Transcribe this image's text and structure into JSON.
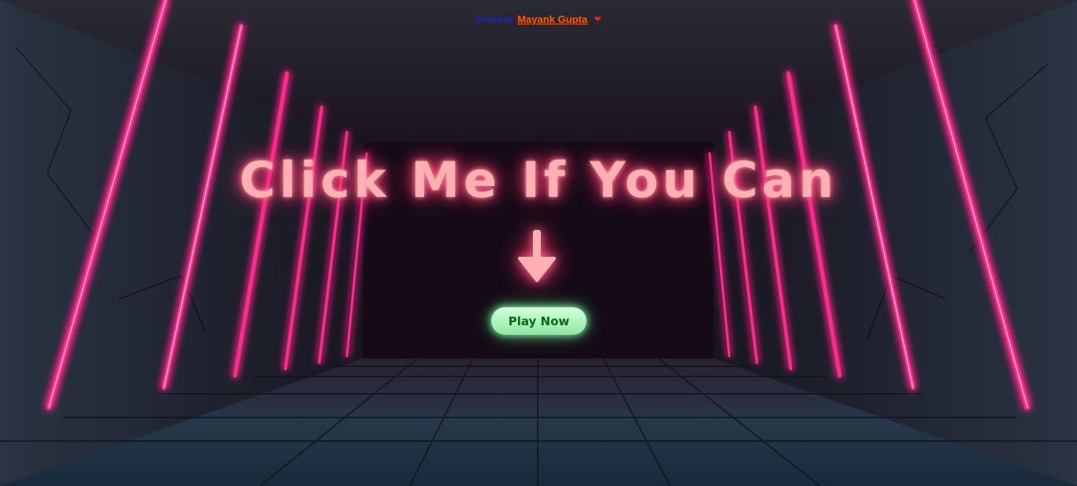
{
  "credit": {
    "prefix": "Created by",
    "author": "Mayank Gupta",
    "heart": "❤"
  },
  "headline": "Click Me If You Can",
  "arrow_icon": "down-arrow-icon",
  "play_button": {
    "label": "Play Now"
  },
  "colors": {
    "neon_pink": "#ff2a8a",
    "headline_pink": "#ffb1b1",
    "button_green": "#a9f2b9",
    "button_text": "#0b6b12",
    "credit_blue": "#1a1aff",
    "credit_orange": "#ff5a00"
  }
}
